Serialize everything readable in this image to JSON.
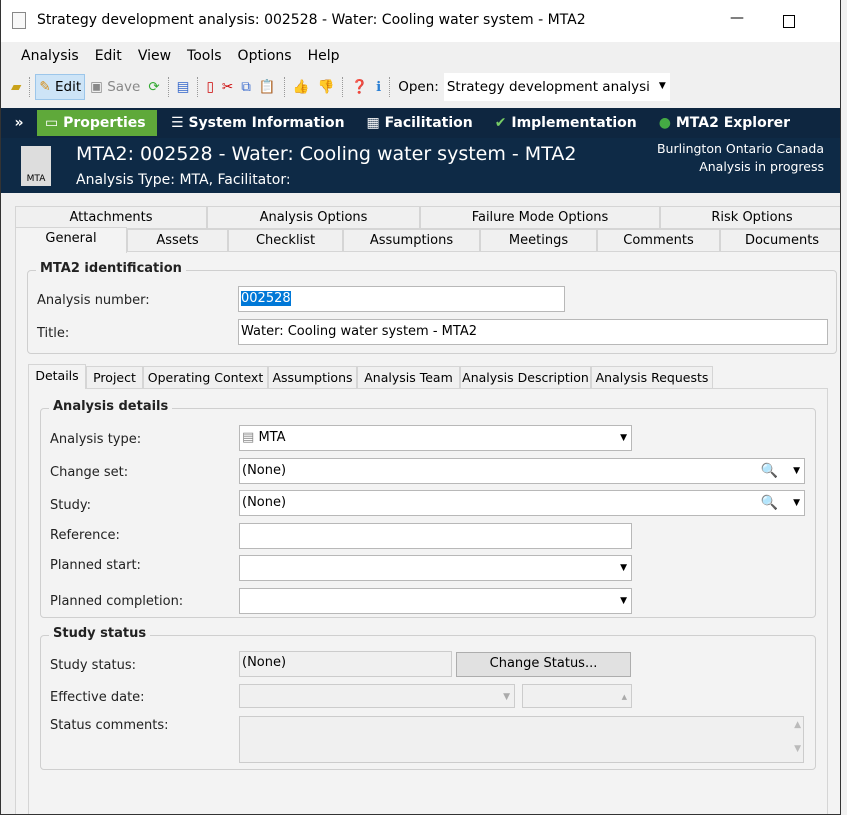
{
  "window": {
    "title": "Strategy development analysis: 002528 - Water: Cooling water system - MTA2",
    "minimize": "—",
    "maximize": "☐"
  },
  "menu": [
    "Analysis",
    "Edit",
    "View",
    "Tools",
    "Options",
    "Help"
  ],
  "toolbar": {
    "edit": "Edit",
    "save": "Save",
    "open_label": "Open:",
    "open_value": "Strategy development analysi"
  },
  "nav": {
    "items": [
      "Properties",
      "System Information",
      "Facilitation",
      "Implementation",
      "MTA2 Explorer"
    ],
    "active": "Properties",
    "active_color": "#5fa93a"
  },
  "header": {
    "title": "MTA2: 002528 - Water: Cooling water system - MTA2",
    "subtitle": "Analysis Type: MTA, Facilitator:",
    "location": "Burlington Ontario Canada",
    "status": "Analysis in progress",
    "icon_label": "MTA"
  },
  "tabs": {
    "row1": [
      "Attachments",
      "Analysis Options",
      "Failure Mode Options",
      "Risk Options"
    ],
    "row2": [
      "General",
      "Assets",
      "Checklist",
      "Assumptions",
      "Meetings",
      "Comments",
      "Documents"
    ],
    "active": "General"
  },
  "identification": {
    "title": "MTA2 identification",
    "number_label": "Analysis number:",
    "number_value": "002528",
    "title_label": "Title:",
    "title_value": "Water: Cooling water system - MTA2"
  },
  "subtabs": {
    "items": [
      "Details",
      "Project",
      "Operating Context",
      "Assumptions",
      "Analysis Team",
      "Analysis Description",
      "Analysis Requests"
    ],
    "active": "Details"
  },
  "details": {
    "title": "Analysis details",
    "type_label": "Analysis type:",
    "type_value": "MTA",
    "changeset_label": "Change set:",
    "changeset_value": "(None)",
    "study_label": "Study:",
    "study_value": "(None)",
    "reference_label": "Reference:",
    "reference_value": "",
    "planned_start_label": "Planned start:",
    "planned_start_value": "",
    "planned_completion_label": "Planned completion:",
    "planned_completion_value": ""
  },
  "study_status": {
    "title": "Study status",
    "status_label": "Study status:",
    "status_value": "(None)",
    "change_button": "Change Status...",
    "effective_label": "Effective date:",
    "comments_label": "Status comments:"
  }
}
